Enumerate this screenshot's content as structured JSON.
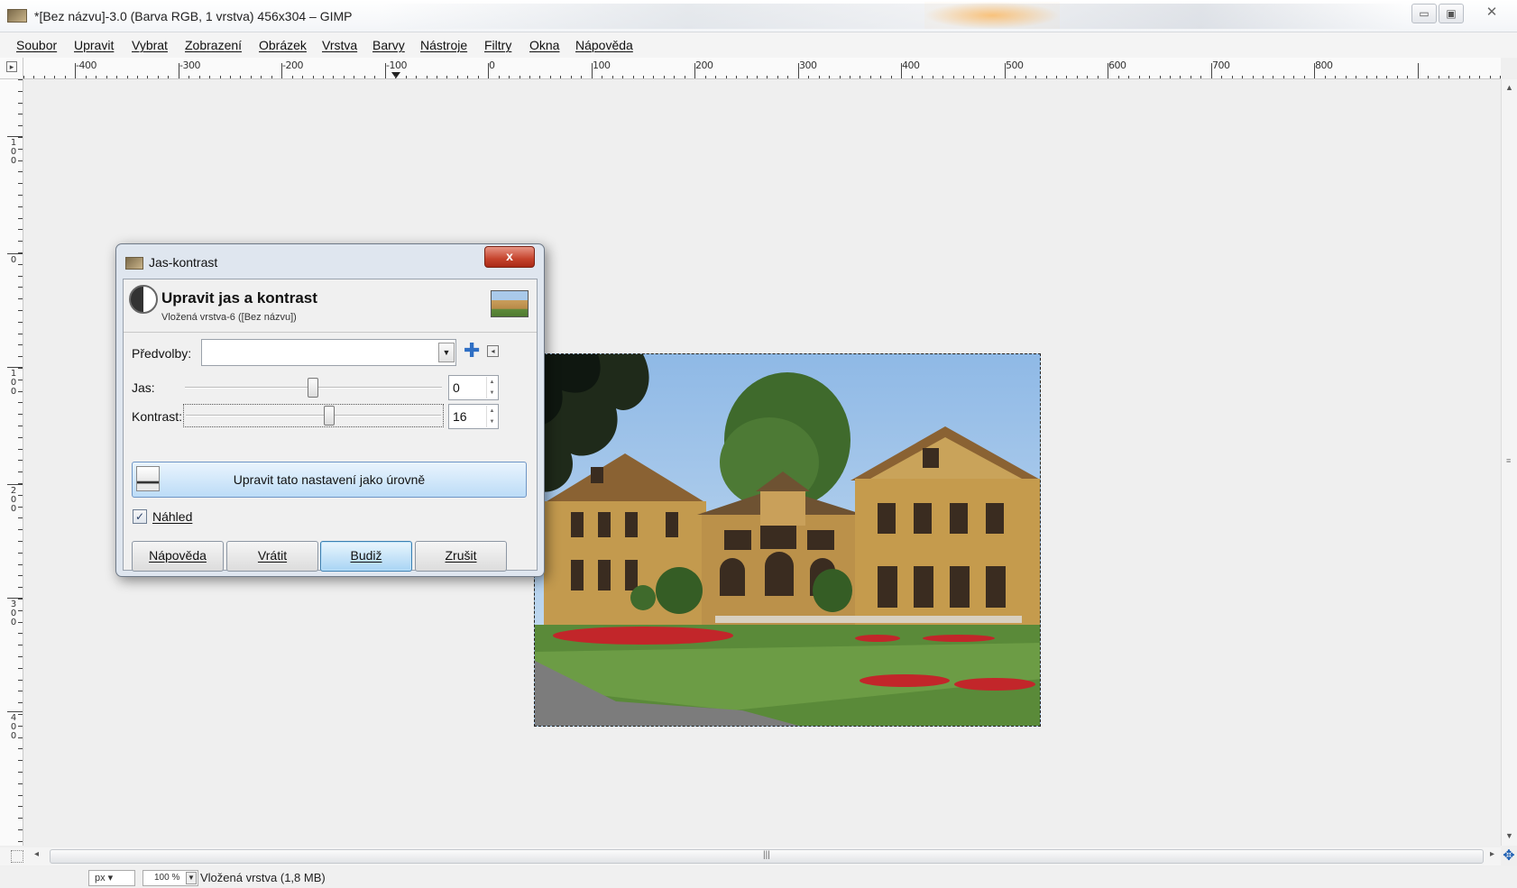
{
  "window": {
    "title": "*[Bez názvu]-3.0 (Barva RGB, 1 vrstva) 456x304 – GIMP",
    "controls": {
      "minimize": "▭",
      "maximize": "▣",
      "close": "✕"
    }
  },
  "menubar": {
    "items": [
      "Soubor",
      "Upravit",
      "Vybrat",
      "Zobrazení",
      "Obrázek",
      "Vrstva",
      "Barvy",
      "Nástroje",
      "Filtry",
      "Okna",
      "Nápověda"
    ]
  },
  "rulers": {
    "horizontal_labels": [
      "-400",
      "-300",
      "-200",
      "-100",
      "0",
      "100",
      "200",
      "300",
      "400",
      "500",
      "600",
      "700",
      "800"
    ],
    "vertical_labels": [
      "100",
      "0",
      "100",
      "200",
      "300",
      "400"
    ]
  },
  "dialog": {
    "title": "Jas-kontrast",
    "close": "x",
    "header_title": "Upravit jas a kontrast",
    "header_subtitle": "Vložená vrstva-6 ([Bez názvu])",
    "presets_label": "Předvolby:",
    "presets_value": "",
    "brightness_label": "Jas:",
    "brightness_value": "0",
    "contrast_label": "Kontrast:",
    "contrast_value": "16",
    "levels_button": "Upravit tato nastavení jako úrovně",
    "preview_label": "Náhled",
    "preview_checked": true,
    "buttons": {
      "help": "Nápověda",
      "reset": "Vrátit",
      "ok": "Budiž",
      "cancel": "Zrušit"
    }
  },
  "statusbar": {
    "unit": "px",
    "zoom": "100 %",
    "text": "Vložená vrstva (1,8 MB)"
  },
  "icons": {
    "app": "gimp-icon",
    "add_preset": "plus-icon",
    "preset_menu": "menu-arrow-icon",
    "navigate": "navigate-icon"
  },
  "colors": {
    "dialog_close": "#c5432c",
    "accent_button": "#a8d4f4",
    "add_icon": "#2f6fc4"
  }
}
